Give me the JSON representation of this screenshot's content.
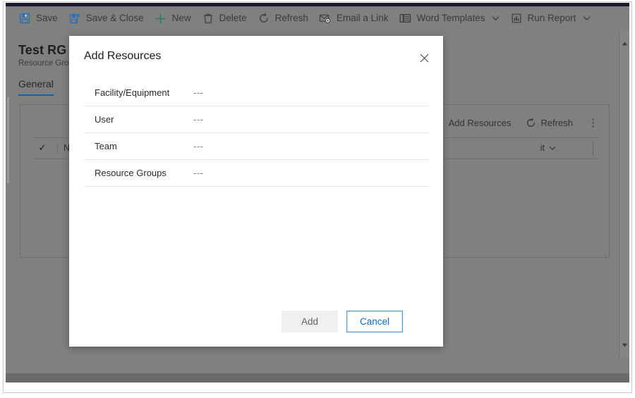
{
  "window": {
    "titlebar_strip_color": "#1b1b2f",
    "overlay_color": "#808080",
    "accent_color": "#0f62b0"
  },
  "command_bar": {
    "items": [
      {
        "label": "Save",
        "icon": "save-floppy-icon",
        "caret": false
      },
      {
        "label": "Save & Close",
        "icon": "save-and-close-icon",
        "caret": false
      },
      {
        "label": "New",
        "icon": "plus-icon",
        "caret": false
      },
      {
        "label": "Delete",
        "icon": "trash-icon",
        "caret": false
      },
      {
        "label": "Refresh",
        "icon": "refresh-icon",
        "caret": false
      },
      {
        "label": "Email a Link",
        "icon": "email-link-icon",
        "caret": false
      },
      {
        "label": "Word Templates",
        "icon": "word-template-icon",
        "caret": true
      },
      {
        "label": "Run Report",
        "icon": "run-report-icon",
        "caret": true
      }
    ]
  },
  "record_header": {
    "title": "Test RG",
    "subtitle": "Resource Gro"
  },
  "tabs": [
    {
      "label": "General",
      "selected": true
    }
  ],
  "subgrid": {
    "toolbar": [
      {
        "label": "Add Resources",
        "icon": "add-resources-icon"
      },
      {
        "label": "Refresh",
        "icon": "refresh-icon"
      }
    ],
    "overflow_label": "⋮",
    "columns": [
      {
        "label": "Na",
        "caret": false
      },
      {
        "label": "it",
        "caret": true
      }
    ]
  },
  "dialog": {
    "title": "Add Resources",
    "close_icon": "close-icon",
    "rows": [
      {
        "label": "Facility/Equipment",
        "value": "---"
      },
      {
        "label": "User",
        "value": "---"
      },
      {
        "label": "Team",
        "value": "---"
      },
      {
        "label": "Resource Groups",
        "value": "---"
      }
    ],
    "buttons": {
      "add_label": "Add",
      "cancel_label": "Cancel"
    }
  }
}
